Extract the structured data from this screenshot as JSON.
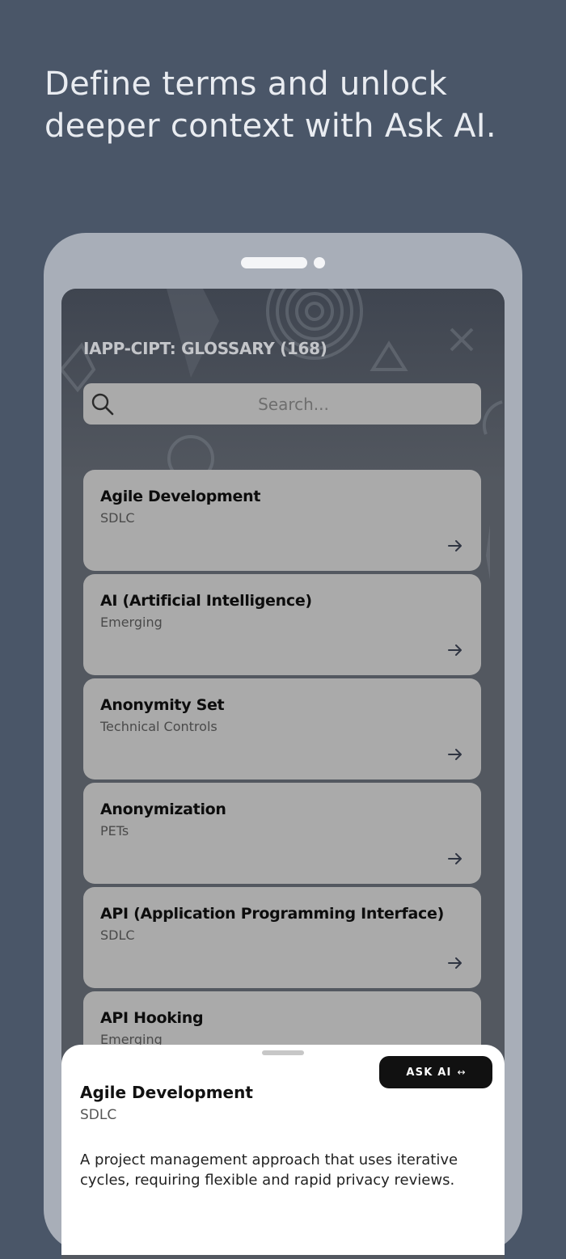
{
  "headline": "Define terms and unlock deeper context with Ask AI.",
  "app": {
    "title": "IAPP-CIPT: GLOSSARY (168)",
    "search_placeholder": "Search..."
  },
  "terms": [
    {
      "term": "Agile Development",
      "category": "SDLC"
    },
    {
      "term": "AI (Artificial Intelligence)",
      "category": "Emerging"
    },
    {
      "term": "Anonymity Set",
      "category": "Technical Controls"
    },
    {
      "term": "Anonymization",
      "category": "PETs"
    },
    {
      "term": "API (Application Programming Interface)",
      "category": "SDLC"
    },
    {
      "term": "API Hooking",
      "category": "Emerging"
    }
  ],
  "detail": {
    "ask_ai_label": "ASK AI",
    "ask_ai_icon": "↔",
    "term": "Agile Development",
    "category": "SDLC",
    "definition": "A project management approach that uses iterative cycles, requiring flexible and rapid privacy reviews."
  },
  "colors": {
    "background": "#4a5668",
    "phone_frame": "#a8aeb8",
    "card": "#aaaaaa",
    "ask_ai_button": "#111111"
  }
}
